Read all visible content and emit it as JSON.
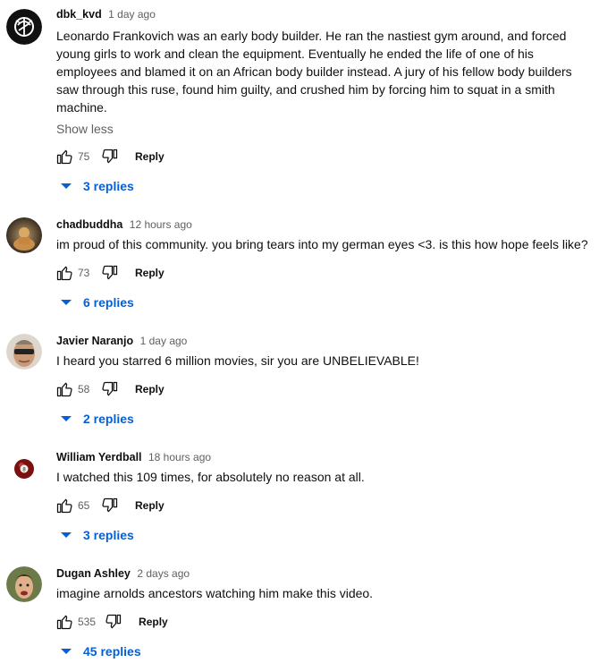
{
  "comments": [
    {
      "author": "dbk_kvd",
      "time": "1 day ago",
      "text": "Leonardo Frankovich was an early body builder. He ran the nastiest gym around, and forced young girls to work and clean the equipment. Eventually he ended the life of one of his employees and blamed it on an African body builder instead. A jury of his fellow body builders saw through this ruse, found him guilty, and crushed him by forcing him to squat in a smith machine.",
      "show_less": "Show less",
      "likes": "75",
      "reply_label": "Reply",
      "replies": "3 replies"
    },
    {
      "author": "chadbuddha",
      "time": "12 hours ago",
      "text": "im proud of this community. you bring tears into my german eyes <3. is this how hope feels like?",
      "likes": "73",
      "reply_label": "Reply",
      "replies": "6 replies"
    },
    {
      "author": "Javier Naranjo",
      "time": "1 day ago",
      "text": "I heard you starred 6 million movies, sir you are UNBELIEVABLE!",
      "likes": "58",
      "reply_label": "Reply",
      "replies": "2 replies"
    },
    {
      "author": "William Yerdball",
      "time": "18 hours ago",
      "text": "I watched this 109 times, for absolutely no reason at all.",
      "likes": "65",
      "reply_label": "Reply",
      "replies": "3 replies"
    },
    {
      "author": "Dugan Ashley",
      "time": "2 days ago",
      "text": "imagine arnolds ancestors watching him make this video.",
      "likes": "535",
      "reply_label": "Reply",
      "replies": "45 replies"
    }
  ],
  "colors": {
    "link_blue": "#065fd4",
    "secondary_text": "#606060",
    "primary_text": "#0f0f0f"
  },
  "icons": {
    "like": "thumbs-up-icon",
    "dislike": "thumbs-down-icon",
    "replies": "caret-down-icon"
  }
}
